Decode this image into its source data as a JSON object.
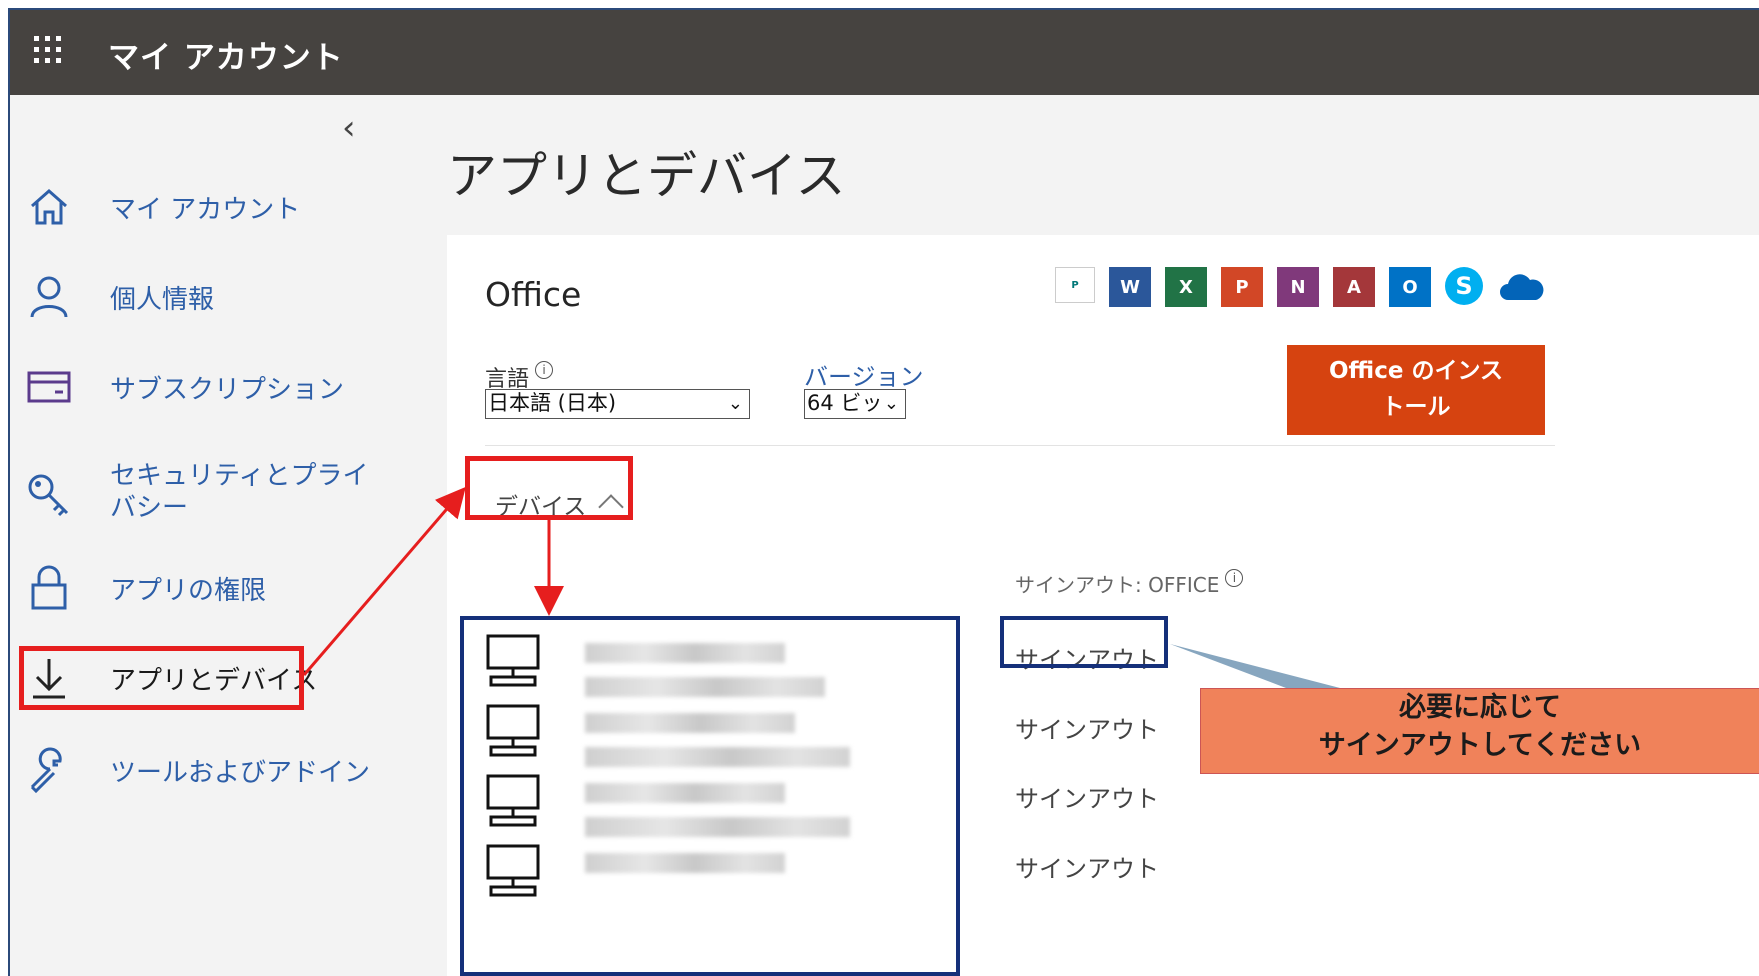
{
  "header": {
    "title": "マイ アカウント"
  },
  "sidebar": {
    "collapse_glyph": "‹",
    "items": [
      {
        "label": "マイ アカウント",
        "icon": "home-icon"
      },
      {
        "label": "個人情報",
        "icon": "person-icon"
      },
      {
        "label": "サブスクリプション",
        "icon": "card-icon"
      },
      {
        "label": "セキュリティとプライバシー",
        "icon": "key-icon"
      },
      {
        "label": "アプリの権限",
        "icon": "lock-icon"
      },
      {
        "label": "アプリとデバイス",
        "icon": "download-icon",
        "selected": true
      },
      {
        "label": "ツールおよびアドイン",
        "icon": "wrench-icon"
      }
    ]
  },
  "main": {
    "title": "アプリとデバイス",
    "office": {
      "title": "Office",
      "app_icons": [
        "Publisher",
        "W",
        "X",
        "P",
        "N",
        "A",
        "O",
        "S",
        "OneDrive"
      ],
      "language_label": "言語",
      "language_value": "日本語 (日本)",
      "version_label": "バージョン",
      "version_value": "64 ビッ",
      "install_button": "Office のインストール",
      "install_line1": "Office のインス",
      "install_line2": "トール"
    },
    "devices": {
      "header": "デバイス",
      "signout_header": "サインアウト: OFFICE",
      "signout_label": "サインアウト",
      "rows": 4
    }
  },
  "annotation": {
    "callout_line1": "必要に応じて",
    "callout_line2": "サインアウトしてください"
  },
  "colors": {
    "topbar": "#464340",
    "accent": "#2e5fa8",
    "install": "#d64310",
    "highlight_red": "#e61e1e",
    "highlight_blue": "#15307a",
    "callout": "#f0825a"
  }
}
